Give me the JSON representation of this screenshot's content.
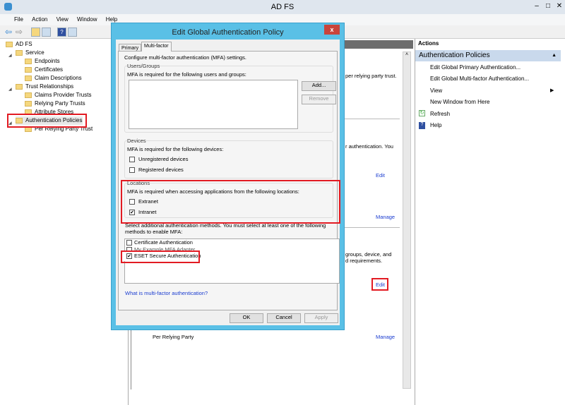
{
  "app": {
    "title": "AD FS"
  },
  "menu": [
    "File",
    "Action",
    "View",
    "Window",
    "Help"
  ],
  "tree": {
    "root": "AD FS",
    "service": "Service",
    "endpoints": "Endpoints",
    "certificates": "Certificates",
    "claim_descriptions": "Claim Descriptions",
    "trust": "Trust Relationships",
    "claims_provider": "Claims Provider Trusts",
    "relying_party": "Relying Party Trusts",
    "attribute_stores": "Attribute Stores",
    "auth_policies": "Authentication Policies",
    "per_rp": "Per Relying Party Trust"
  },
  "center": {
    "text1": "per relying party trust.",
    "text2": "r authentication. You",
    "edit1": "Edit",
    "manage1": "Manage",
    "text3": "groups, device, and",
    "text4": "d requirements.",
    "edit2": "Edit",
    "per_rp": "Per Relying Party",
    "manage2": "Manage"
  },
  "actions": {
    "header": "Actions",
    "section": "Authentication Policies",
    "items": [
      "Edit Global Primary Authentication...",
      "Edit Global Multi-factor Authentication...",
      "View",
      "New Window from Here",
      "Refresh",
      "Help"
    ]
  },
  "dialog": {
    "title": "Edit Global Authentication Policy",
    "close": "x",
    "tabs": [
      "Primary",
      "Multi-factor"
    ],
    "intro": "Configure multi-factor authentication (MFA) settings.",
    "users": {
      "label": "Users/Groups",
      "desc": "MFA is required for the following users and groups:",
      "add": "Add...",
      "remove": "Remove"
    },
    "devices": {
      "label": "Devices",
      "desc": "MFA is required for the following devices:",
      "items": [
        {
          "label": "Unregistered devices",
          "checked": false
        },
        {
          "label": "Registered devices",
          "checked": false
        }
      ]
    },
    "locations": {
      "label": "Locations",
      "desc": "MFA is required when accessing applications from the following locations:",
      "items": [
        {
          "label": "Extranet",
          "checked": false
        },
        {
          "label": "Intranet",
          "checked": true
        }
      ]
    },
    "methods_desc": "Select additional authentication methods. You must select at least one of the following methods to enable MFA:",
    "methods": [
      {
        "label": "Certificate Authentication",
        "checked": false
      },
      {
        "label": "My Example MFA Adapter",
        "checked": false
      },
      {
        "label": "ESET Secure Authentication",
        "checked": true
      }
    ],
    "help_link": "What is multi-factor authentication?",
    "ok": "OK",
    "cancel": "Cancel",
    "apply": "Apply"
  }
}
